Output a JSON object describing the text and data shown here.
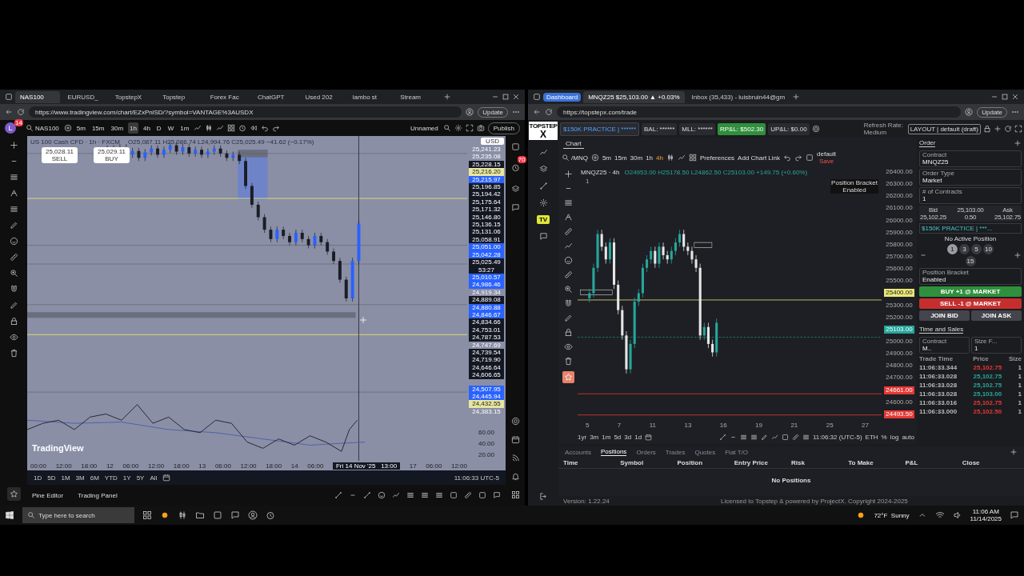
{
  "left_window": {
    "tabs": [
      {
        "label": "NAS100",
        "selected": true
      },
      {
        "label": "EURUSD_",
        "selected": false
      },
      {
        "label": "TopstepX",
        "selected": false
      },
      {
        "label": "Topstep",
        "selected": false
      },
      {
        "label": "Forex Fac",
        "selected": false
      },
      {
        "label": "ChatGPT",
        "selected": false
      },
      {
        "label": "Used 202",
        "selected": false
      },
      {
        "label": "lambo st",
        "selected": false
      },
      {
        "label": "Stream",
        "selected": false
      }
    ],
    "address": "https://www.tradingview.com/chart/EZxPnlSD/?symbol=VANTAGE%3AUSDX",
    "update_button": "Update",
    "avatar": "L",
    "notification_count": "14",
    "symbol": "NAS100",
    "intervals": [
      {
        "label": "5m",
        "selected": false
      },
      {
        "label": "15m",
        "selected": false
      },
      {
        "label": "30m",
        "selected": false
      },
      {
        "label": "1h",
        "selected": true
      },
      {
        "label": "4h",
        "selected": false
      },
      {
        "label": "D",
        "selected": false
      },
      {
        "label": "W",
        "selected": false
      },
      {
        "label": "1m",
        "selected": false
      }
    ],
    "layout_name": "Unnamed",
    "publish_button": "Publish",
    "chart": {
      "legend_title": "US 100 Cash CFD · 1h · FXCM",
      "legend_values": "O25,087.11 H25,086.74 L24,994.76 C25,025.49 −41.62 (−0.17%)",
      "sell_price": "25,028.11",
      "sell_label": "SELL",
      "buy_price": "25,029.11",
      "buy_label": "BUY",
      "currency": "USD",
      "alert_badge": "70",
      "price_labels": [
        {
          "text": "25,241.23",
          "color": "#8a8fa6"
        },
        {
          "text": "25,235.08",
          "color": "#8a8fa6"
        },
        {
          "text": "25,228.15",
          "color": "#131722"
        },
        {
          "text": "25,216.20",
          "color": "#e8e6a0"
        },
        {
          "text": "25,215.97",
          "color": "#2962ff"
        },
        {
          "text": "25,196.85",
          "color": "#131722"
        },
        {
          "text": "25,194.42",
          "color": "#131722"
        },
        {
          "text": "25,175.64",
          "color": "#131722"
        },
        {
          "text": "25,171.32",
          "color": "#131722"
        },
        {
          "text": "25,146.80",
          "color": "#131722"
        },
        {
          "text": "25,136.15",
          "color": "#131722"
        },
        {
          "text": "25,131.06",
          "color": "#131722"
        },
        {
          "text": "25,058.91",
          "color": "#131722"
        },
        {
          "text": "25,051.00",
          "color": "#2962ff"
        },
        {
          "text": "25,042.28",
          "color": "#2962ff"
        },
        {
          "text": "25,025.49",
          "color": "#131722"
        },
        {
          "text": "53:27",
          "color": "#131722"
        },
        {
          "text": "25,010.57",
          "color": "#2962ff"
        },
        {
          "text": "24,986.46",
          "color": "#2962ff"
        },
        {
          "text": "24,919.34",
          "color": "#8a8fa6"
        },
        {
          "text": "24,889.08",
          "color": "#131722"
        },
        {
          "text": "24,880.88",
          "color": "#2962ff"
        },
        {
          "text": "24,846.67",
          "color": "#2962ff"
        },
        {
          "text": "24,834.66",
          "color": "#131722"
        },
        {
          "text": "24,753.01",
          "color": "#131722"
        },
        {
          "text": "24,787.53",
          "color": "#131722"
        },
        {
          "text": "24,747.69",
          "color": "#8a8fa6"
        },
        {
          "text": "24,739.54",
          "color": "#131722"
        },
        {
          "text": "24,719.90",
          "color": "#131722"
        },
        {
          "text": "24,646.64",
          "color": "#131722"
        },
        {
          "text": "24,606.65",
          "color": "#131722"
        },
        {
          "text": "24,507.95",
          "color": "#2962ff"
        },
        {
          "text": "24,445.94",
          "color": "#2962ff"
        },
        {
          "text": "24,432.55",
          "color": "#e8e6a0"
        },
        {
          "text": "24,383.15",
          "color": "#8a8fa6"
        }
      ],
      "oscillator_labels": [
        "60.00",
        "40.00",
        "20.00"
      ],
      "logo": "TradingView",
      "time_labels": [
        "00:00",
        "12:00",
        "18:00",
        "12",
        "06:00",
        "12:00",
        "18:00",
        "13",
        "06:00",
        "12:00",
        "18:00",
        "14",
        "06:00"
      ],
      "crosshair_time": "Fri 14 Nov '25   13:00",
      "time_labels_after": [
        "17",
        "06:00",
        "12:00"
      ]
    },
    "ranges": [
      "1D",
      "5D",
      "1M",
      "3M",
      "6M",
      "YTD",
      "1Y",
      "5Y",
      "All"
    ],
    "clock": "11:06:33 UTC-5",
    "bottom_tabs": [
      "Pine Editor",
      "Trading Panel"
    ]
  },
  "right_window": {
    "group_label": "Dashboard",
    "tabs": [
      {
        "label": "MNQZ25 $25,103.00 ▲ +0.03%",
        "selected": true
      },
      {
        "label": "Inbox (35,433) - luisbruin44@gm",
        "selected": false
      }
    ],
    "address": "https://topstepx.com/trade",
    "update_button": "Update",
    "logo_top": "TOPSTEP",
    "logo_mark": "X",
    "tv_badge": "TV",
    "account": "$150K PRACTICE | ******",
    "balance": "BAL: ******",
    "mll": "MLL: ******",
    "realized_pnl": "RP&L: $502.30",
    "unrealized_pnl": "UP&L: $0.00",
    "refresh_rate": "Refresh Rate: Medium",
    "layout": "LAYOUT | default (draft)",
    "chart_tab": "Chart",
    "symbol": "/MNQ",
    "intervals": [
      {
        "label": "5m",
        "selected": false
      },
      {
        "label": "15m",
        "selected": false
      },
      {
        "label": "30m",
        "selected": false
      },
      {
        "label": "1h",
        "selected": false
      },
      {
        "label": "4h",
        "selected": true
      }
    ],
    "preferences": "Preferences",
    "add_chart_link": "Add Chart Link",
    "template": "default",
    "template_status": "Save",
    "chart": {
      "legend_title": "MNQZ25 · 4h",
      "legend_values": "O24953.00 H25178.50 L24862.50 C25103.00 +149.75 (+0.60%)",
      "pane_count": "1",
      "bracket_note": "Position Bracket Enabled",
      "axis_labels": [
        {
          "text": "26400.00"
        },
        {
          "text": "26300.00"
        },
        {
          "text": "26200.00"
        },
        {
          "text": "26100.00"
        },
        {
          "text": "26000.00"
        },
        {
          "text": "25900.00"
        },
        {
          "text": "25800.00"
        },
        {
          "text": "25700.00"
        },
        {
          "text": "25600.00"
        },
        {
          "text": "25500.00"
        },
        {
          "text": "25400.00",
          "color": "#e8e87a"
        },
        {
          "text": "25300.00"
        },
        {
          "text": "25200.00"
        },
        {
          "text": "25103.00",
          "color": "#26a69a"
        },
        {
          "text": "25000.00"
        },
        {
          "text": "24900.00"
        },
        {
          "text": "24800.00"
        },
        {
          "text": "24700.00"
        },
        {
          "text": "24661.00",
          "color": "#e53935"
        },
        {
          "text": "24600.00"
        },
        {
          "text": "24493.50",
          "color": "#e53935"
        }
      ],
      "date_labels": [
        "5",
        "7",
        "11",
        "13",
        "16",
        "19",
        "21",
        "25",
        "27"
      ]
    },
    "ranges": [
      "1yr",
      "3m",
      "1m",
      "5d",
      "3d",
      "1d"
    ],
    "clock": "11:06:32 (UTC-5)",
    "session": "ETH",
    "scale_options": [
      "%",
      "log",
      "auto"
    ],
    "order": {
      "tab": "Order",
      "contract_label": "Contract",
      "contract": "MNQZ25",
      "order_type_label": "Order Type",
      "order_type": "Market",
      "contracts_label": "# of Contracts",
      "contracts": "1",
      "bid_label": "Bid",
      "bid": "25,102.25",
      "last": "25,103.00",
      "spread": "0.50",
      "ask_label": "Ask",
      "ask": "25,102.75",
      "account": "$150K PRACTICE | ***...",
      "position_status": "No Active Position",
      "quantities": [
        {
          "label": "1",
          "selected": true
        },
        {
          "label": "3",
          "selected": false
        },
        {
          "label": "5",
          "selected": false
        },
        {
          "label": "10",
          "selected": false
        },
        {
          "label": "15",
          "selected": false
        }
      ],
      "bracket_label": "Position Bracket",
      "bracket_value": "Enabled",
      "buy_button": "BUY +1 @ MARKET",
      "sell_button": "SELL -1 @ MARKET",
      "join_bid": "JOIN BID",
      "join_ask": "JOIN ASK"
    },
    "time_and_sales": {
      "title": "Time and Sales",
      "contract_label": "Contract",
      "contract": "M..",
      "size_label": "Size F...",
      "size": "1",
      "columns": [
        "Trade Time",
        "Price",
        "Size"
      ],
      "rows": [
        {
          "time": "11:06:33.344",
          "price": "25,102.75",
          "size": "1",
          "color": "#e53935"
        },
        {
          "time": "11:06:33.028",
          "price": "25,102.75",
          "size": "1",
          "color": "#26a69a"
        },
        {
          "time": "11:06:33.028",
          "price": "25,102.75",
          "size": "1",
          "color": "#26a69a"
        },
        {
          "time": "11:06:33.028",
          "price": "25,103.00",
          "size": "1",
          "color": "#26a69a"
        },
        {
          "time": "11:06:33.016",
          "price": "25,102.75",
          "size": "1",
          "color": "#e53935"
        },
        {
          "time": "11:06:33.000",
          "price": "25,102.50",
          "size": "1",
          "color": "#e53935"
        }
      ]
    },
    "positions": {
      "tabs": [
        {
          "label": "Accounts",
          "selected": false
        },
        {
          "label": "Positions",
          "selected": true
        },
        {
          "label": "Orders",
          "selected": false
        },
        {
          "label": "Trades",
          "selected": false
        },
        {
          "label": "Quotes",
          "selected": false
        },
        {
          "label": "Flat T/O",
          "selected": false
        }
      ],
      "columns": [
        "Time",
        "Symbol",
        "Position",
        "Entry Price",
        "Risk",
        "To Make",
        "P&L",
        "Close"
      ],
      "empty_message": "No Positions"
    },
    "version": "Version: 1.22.24",
    "license": "Licensed to Topstep & powered by ProjectX. Copyright 2024-2025"
  },
  "taskbar": {
    "search_placeholder": "Type here to search",
    "weather": "72°F  Sunny",
    "time": "11:06 AM",
    "date": "11/14/2025"
  }
}
